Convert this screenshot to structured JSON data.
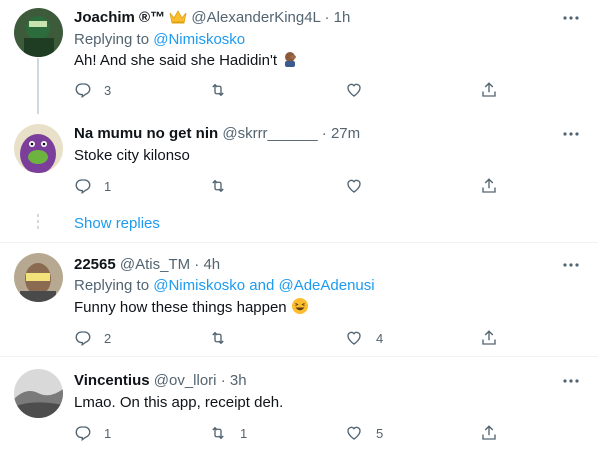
{
  "colors": {
    "accent": "#1d9bf0",
    "muted": "#536471",
    "text": "#0f1419",
    "divider": "#eff3f4",
    "emoji_yellow": "#fbbd2e"
  },
  "tweets": [
    {
      "name": "Joachim ®™",
      "badge_icon": "crown-emoji-icon",
      "handle": "@AlexanderKing4L",
      "time": "· 1h",
      "replying_prefix": "Replying to",
      "replying_to": "@Nimiskosko",
      "text": "Ah! And she said she Hadidin't",
      "text_emoji_icon": "facepalm-emoji-icon",
      "replies": "3",
      "retweets": "",
      "likes": ""
    },
    {
      "name": "Na mumu no get nin",
      "handle": "@skrrr______",
      "time": "· 27m",
      "text": "Stoke city kilonso",
      "replies": "1",
      "retweets": "",
      "likes": ""
    },
    {
      "name": "22565",
      "handle": "@Atis_TM",
      "time": "· 4h",
      "replying_prefix": "Replying to",
      "replying_to": "@Nimiskosko and @AdeAdenusi",
      "text": "Funny how these things happen",
      "text_emoji_icon": "laughing-emoji-icon",
      "replies": "2",
      "retweets": "",
      "likes": "4"
    },
    {
      "name": "Vincentius",
      "handle": "@ov_llori",
      "time": "· 3h",
      "text": "Lmao. On this app, receipt deh.",
      "replies": "1",
      "retweets": "1",
      "likes": "5"
    }
  ],
  "show_replies_label": "Show replies"
}
